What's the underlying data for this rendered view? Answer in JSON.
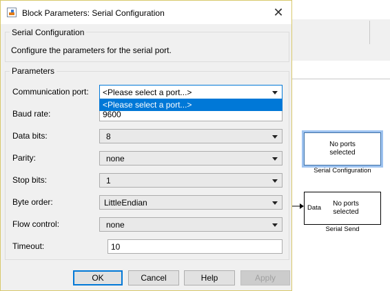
{
  "window": {
    "title": "Block Parameters: Serial Configuration",
    "close_symbol": "✕"
  },
  "group_serial": {
    "title": "Serial Configuration",
    "description": "Configure the parameters for the serial port."
  },
  "group_params": {
    "title": "Parameters",
    "fields": {
      "communication_port": {
        "label": "Communication port:",
        "value": "<Please select a port...>"
      },
      "baud_rate": {
        "label": "Baud rate:",
        "value": "9600"
      },
      "data_bits": {
        "label": "Data bits:",
        "value": "8"
      },
      "parity": {
        "label": "Parity:",
        "value": "none"
      },
      "stop_bits": {
        "label": "Stop bits:",
        "value": "1"
      },
      "byte_order": {
        "label": "Byte order:",
        "value": "LittleEndian"
      },
      "flow_control": {
        "label": "Flow control:",
        "value": "none"
      },
      "timeout": {
        "label": "Timeout:",
        "value": "10"
      }
    },
    "dropdown_open": {
      "options": [
        "<Please select a port...>"
      ],
      "highlighted": "<Please select a port...>"
    }
  },
  "buttons": {
    "ok": "OK",
    "cancel": "Cancel",
    "help": "Help",
    "apply": "Apply"
  },
  "canvas": {
    "serial_config_block": {
      "line1": "No ports",
      "line2": "selected",
      "caption": "Serial Configuration"
    },
    "serial_send_block": {
      "port": "Data",
      "line1": "No ports",
      "line2": "selected",
      "caption": "Serial Send"
    }
  },
  "colors": {
    "accent": "#0078d7",
    "dialog_bg": "#f0f0f0",
    "selection_halo": "#9ec3f0"
  }
}
